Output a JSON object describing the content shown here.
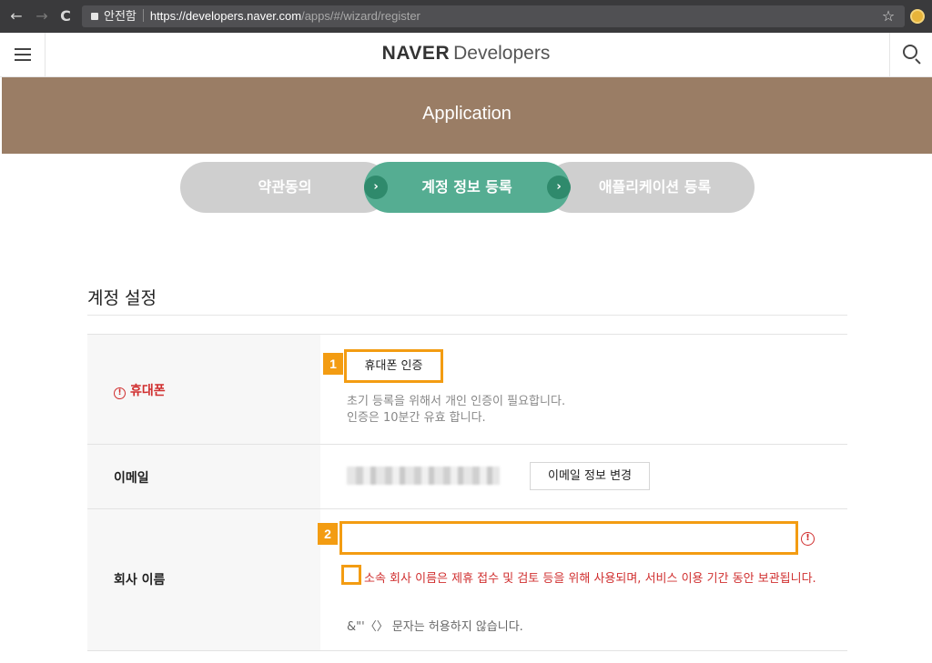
{
  "browser": {
    "security_label": "안전함",
    "url_host": "https://developers.naver.com",
    "url_path": "/apps/#/wizard/register",
    "back": "←",
    "forward": "→",
    "reload": "C",
    "star": "☆"
  },
  "header": {
    "brand": "NAVER",
    "brand_suffix": "Developers"
  },
  "banner": {
    "title": "Application"
  },
  "steps": [
    {
      "label": "약관동의",
      "state": "done"
    },
    {
      "label": "계정 정보 등록",
      "state": "active"
    },
    {
      "label": "애플리케이션 등록",
      "state": "pending"
    }
  ],
  "step_arrow": "›",
  "section": {
    "title": "계정 설정"
  },
  "phone": {
    "label": "휴대폰",
    "alert_mark": "!",
    "verify_button": "휴대폰 인증",
    "helper_line1": "초기 등록을 위해서 개인 인증이 필요합니다.",
    "helper_line2": "인증은 10분간 유효 합니다."
  },
  "email": {
    "label": "이메일",
    "change_button": "이메일 정보 변경"
  },
  "company": {
    "label": "회사 이름",
    "input_value": "",
    "error_mark": "!",
    "agree_text": "소속 회사 이름은 제휴 접수 및 검토 등을 위해 사용되며, 서비스 이용 기간 동안 보관됩니다.",
    "chars_note": "&\"'〈〉 문자는 허용하지 않습니다."
  },
  "markers": [
    "1",
    "2"
  ],
  "colors": {
    "banner": "#9a7d65",
    "step_active": "#55ad92",
    "step_inactive": "#cfcfcf",
    "marker": "#f39c12",
    "error": "#d02f2f"
  }
}
